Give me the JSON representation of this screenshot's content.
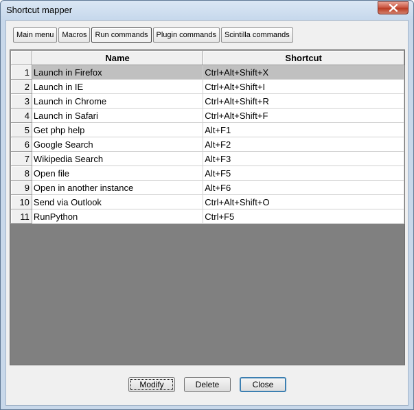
{
  "window": {
    "title": "Shortcut mapper"
  },
  "tabs": [
    {
      "label": "Main menu"
    },
    {
      "label": "Macros"
    },
    {
      "label": "Run commands",
      "active": true
    },
    {
      "label": "Plugin commands"
    },
    {
      "label": "Scintilla commands"
    }
  ],
  "table": {
    "columns": [
      "",
      "Name",
      "Shortcut"
    ],
    "rows": [
      {
        "num": "1",
        "name": "Launch in Firefox",
        "shortcut": "Ctrl+Alt+Shift+X",
        "selected": true
      },
      {
        "num": "2",
        "name": "Launch in IE",
        "shortcut": "Ctrl+Alt+Shift+I"
      },
      {
        "num": "3",
        "name": "Launch in Chrome",
        "shortcut": "Ctrl+Alt+Shift+R"
      },
      {
        "num": "4",
        "name": "Launch in Safari",
        "shortcut": "Ctrl+Alt+Shift+F"
      },
      {
        "num": "5",
        "name": "Get php help",
        "shortcut": "Alt+F1"
      },
      {
        "num": "6",
        "name": "Google Search",
        "shortcut": "Alt+F2"
      },
      {
        "num": "7",
        "name": "Wikipedia Search",
        "shortcut": "Alt+F3"
      },
      {
        "num": "8",
        "name": "Open file",
        "shortcut": "Alt+F5"
      },
      {
        "num": "9",
        "name": "Open in another instance",
        "shortcut": "Alt+F6"
      },
      {
        "num": "10",
        "name": "Send via Outlook",
        "shortcut": "Ctrl+Alt+Shift+O"
      },
      {
        "num": "11",
        "name": "RunPython",
        "shortcut": "Ctrl+F5"
      }
    ]
  },
  "buttons": {
    "modify": "Modify",
    "delete": "Delete",
    "close": "Close"
  },
  "icons": {
    "title_close": "close-icon"
  },
  "colors": {
    "selected_row": "#c0c0c0",
    "grid_empty": "#808080",
    "close_button": "#c7513d"
  }
}
